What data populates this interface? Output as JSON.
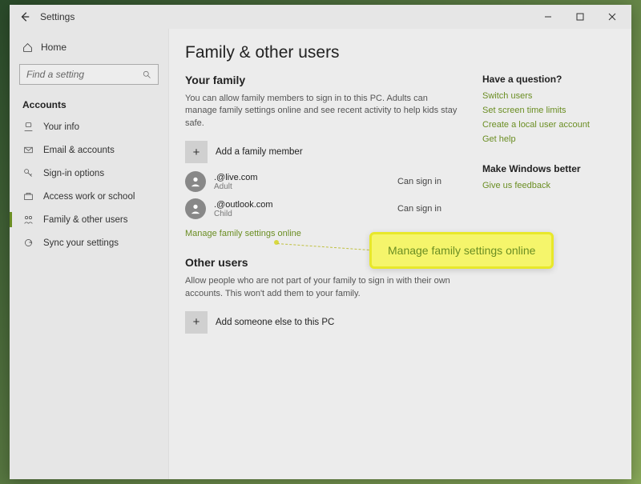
{
  "window": {
    "title": "Settings",
    "page_title": "Family & other users"
  },
  "sidebar": {
    "home_label": "Home",
    "search_placeholder": "Find a setting",
    "section_label": "Accounts",
    "items": [
      {
        "icon": "user",
        "label": "Your info"
      },
      {
        "icon": "mail",
        "label": "Email & accounts"
      },
      {
        "icon": "key",
        "label": "Sign-in options"
      },
      {
        "icon": "briefcase",
        "label": "Access work or school"
      },
      {
        "icon": "family",
        "label": "Family & other users"
      },
      {
        "icon": "sync",
        "label": "Sync your settings"
      }
    ]
  },
  "family": {
    "heading": "Your family",
    "description": "You can allow family members to sign in to this PC. Adults can manage family settings online and see recent activity to help kids stay safe.",
    "add_label": "Add a family member",
    "members": [
      {
        "email": ".@live.com",
        "role": "Adult",
        "status": "Can sign in"
      },
      {
        "email": ".@outlook.com",
        "role": "Child",
        "status": "Can sign in"
      }
    ],
    "manage_link": "Manage family settings online"
  },
  "other_users": {
    "heading": "Other users",
    "description": "Allow people who are not part of your family to sign in with their own accounts. This won't add them to your family.",
    "add_label": "Add someone else to this PC"
  },
  "help": {
    "heading": "Have a question?",
    "links": [
      "Switch users",
      "Set screen time limits",
      "Create a local user account",
      "Get help"
    ]
  },
  "feedback": {
    "heading": "Make Windows better",
    "link": "Give us feedback"
  },
  "callout": {
    "text": "Manage family settings online"
  }
}
